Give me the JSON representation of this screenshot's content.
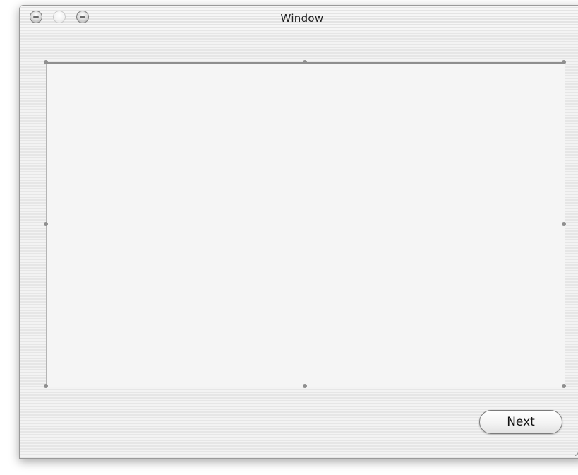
{
  "window": {
    "title": "Window"
  },
  "titlebar": {
    "buttons": [
      "close-icon",
      "minimize-icon",
      "zoom-icon"
    ]
  },
  "footer": {
    "next_label": "Next"
  }
}
